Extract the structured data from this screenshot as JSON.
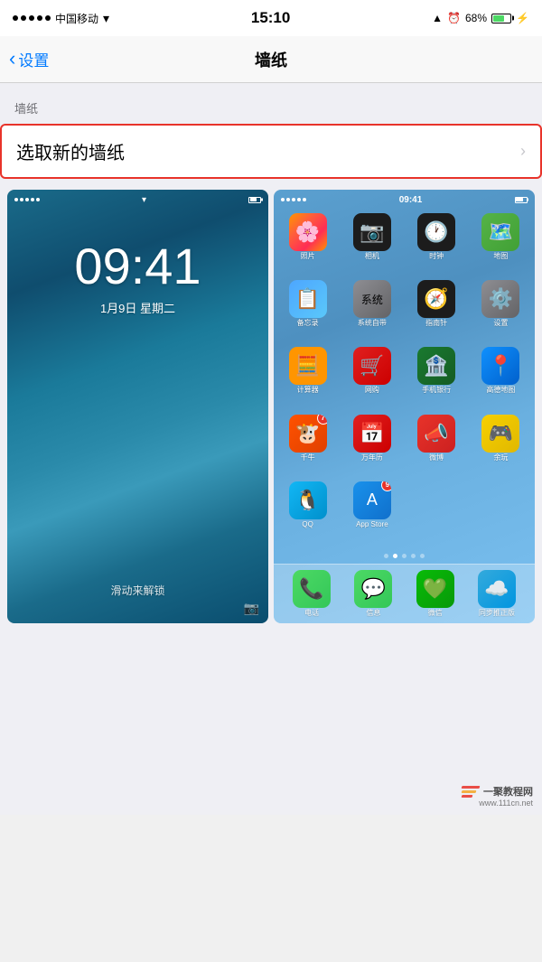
{
  "statusBar": {
    "carrier": "中国移动",
    "time": "15:10",
    "battery": "68%"
  },
  "navBar": {
    "backLabel": "设置",
    "title": "墙纸"
  },
  "section": {
    "label": "墙纸"
  },
  "wallpaperRow": {
    "label": "选取新的墙纸"
  },
  "lockScreen": {
    "time": "09:41",
    "date": "1月9日 星期二",
    "unlockText": "滑动来解锁"
  },
  "homeScreen": {
    "time": "09:41",
    "apps": [
      {
        "label": "照片",
        "badge": ""
      },
      {
        "label": "相机",
        "badge": ""
      },
      {
        "label": "时钟",
        "badge": ""
      },
      {
        "label": "地图",
        "badge": ""
      },
      {
        "label": "备忘录",
        "badge": ""
      },
      {
        "label": "系统自带",
        "badge": ""
      },
      {
        "label": "指南针",
        "badge": ""
      },
      {
        "label": "设置",
        "badge": ""
      },
      {
        "label": "计算器",
        "badge": ""
      },
      {
        "label": "网购",
        "badge": ""
      },
      {
        "label": "手机银行",
        "badge": ""
      },
      {
        "label": "高德地图",
        "badge": ""
      },
      {
        "label": "千牛",
        "badge": "7"
      },
      {
        "label": "万年历",
        "badge": ""
      },
      {
        "label": "微博",
        "badge": ""
      },
      {
        "label": "余玩",
        "badge": ""
      },
      {
        "label": "QQ",
        "badge": ""
      },
      {
        "label": "App Store",
        "badge": "9"
      },
      {
        "label": "",
        "badge": ""
      },
      {
        "label": "",
        "badge": ""
      }
    ],
    "dockApps": [
      {
        "label": "电话"
      },
      {
        "label": "信息"
      },
      {
        "label": "微信"
      },
      {
        "label": "同步推正版"
      }
    ]
  },
  "watermark": {
    "site": "www.111cn.net",
    "name": "一聚教程网"
  }
}
